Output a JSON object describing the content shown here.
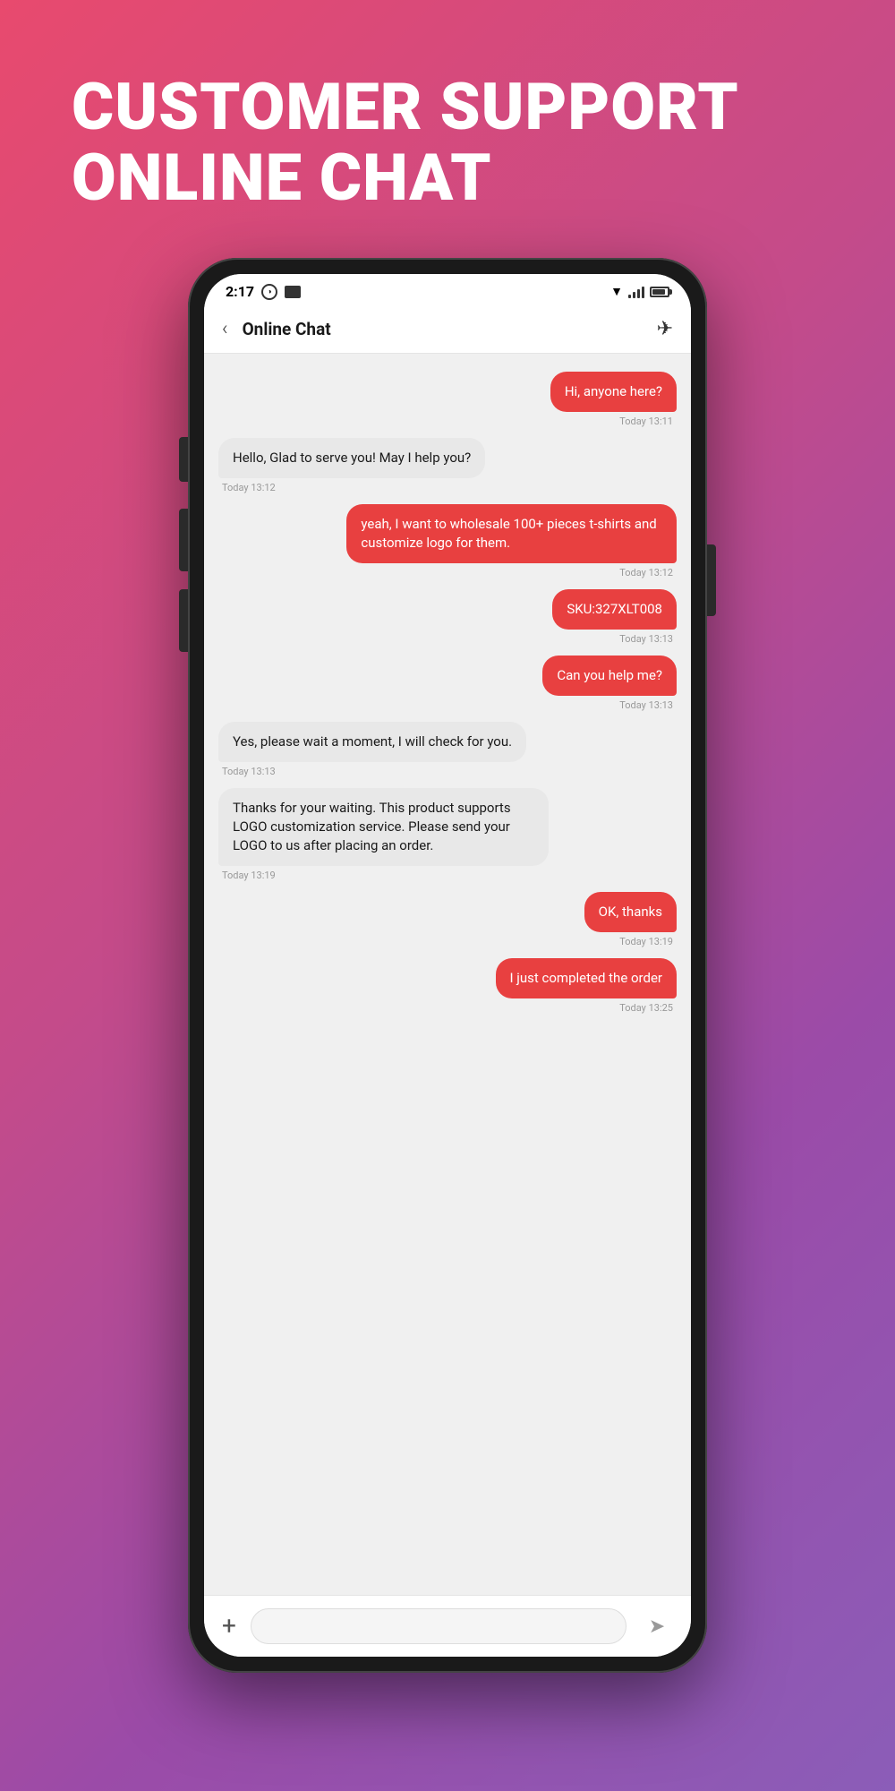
{
  "hero": {
    "title_line1": "CUSTOMER SUPPORT",
    "title_line2": "ONLINE CHAT"
  },
  "status_bar": {
    "time": "2:17",
    "right_icons": "▼◀█"
  },
  "header": {
    "title": "Online Chat",
    "back_label": "‹",
    "pin_icon": "📌"
  },
  "messages": [
    {
      "id": 1,
      "type": "sent",
      "text": "Hi, anyone here?",
      "time": "Today 13:11"
    },
    {
      "id": 2,
      "type": "received",
      "text": "Hello, Glad to serve you! May I help you?",
      "time": "Today 13:12"
    },
    {
      "id": 3,
      "type": "sent",
      "text": "yeah, I want to wholesale 100+ pieces t-shirts and customize logo for them.",
      "time": "Today 13:12"
    },
    {
      "id": 4,
      "type": "sent",
      "text": "SKU:327XLT008",
      "time": "Today 13:13"
    },
    {
      "id": 5,
      "type": "sent",
      "text": "Can you help me?",
      "time": "Today 13:13"
    },
    {
      "id": 6,
      "type": "received",
      "text": "Yes, please wait a moment, I will check for you.",
      "time": "Today 13:13"
    },
    {
      "id": 7,
      "type": "received",
      "text": "Thanks for your waiting. This product supports LOGO customization service. Please send your LOGO to us after placing an order.",
      "time": "Today 13:19"
    },
    {
      "id": 8,
      "type": "sent",
      "text": "OK, thanks",
      "time": "Today 13:19"
    },
    {
      "id": 9,
      "type": "sent",
      "text": "I just completed the order",
      "time": "Today 13:25"
    }
  ],
  "input_bar": {
    "add_label": "+",
    "placeholder": "",
    "send_label": "➤"
  }
}
